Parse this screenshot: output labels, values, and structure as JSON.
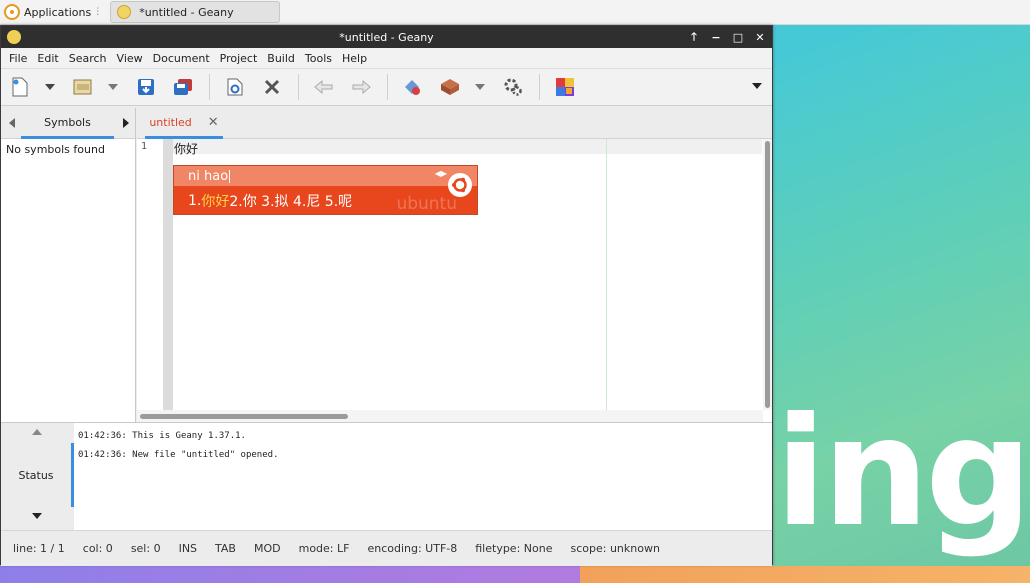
{
  "desktop": {
    "text": "inge"
  },
  "panel": {
    "applications_label": "Applications",
    "task_title": "*untitled - Geany"
  },
  "window": {
    "title": "*untitled - Geany",
    "controls": {
      "up": "🡑",
      "minimize": "−",
      "maximize": "□",
      "close": "✕"
    }
  },
  "menu": {
    "items": [
      "File",
      "Edit",
      "Search",
      "View",
      "Document",
      "Project",
      "Build",
      "Tools",
      "Help"
    ]
  },
  "sidebar": {
    "tab_label": "Symbols",
    "empty_message": "No symbols found"
  },
  "editor": {
    "tab_label": "untitled",
    "line_number": "1",
    "line_text": "你好"
  },
  "ime": {
    "preedit": "ni hao",
    "candidate_first_num": "1.",
    "candidate_first": "你好",
    "candidates_rest": " 2.你 3.拟 4.尼 5.呢",
    "watermark": "ubuntu"
  },
  "messages": {
    "tab_label": "Status",
    "lines": [
      "01:42:36: This is Geany 1.37.1.",
      "01:42:36: New file \"untitled\" opened."
    ]
  },
  "statusbar": {
    "line": "line: 1 / 1",
    "col": "col: 0",
    "sel": "sel: 0",
    "ins": "INS",
    "tab": "TAB",
    "mod": "MOD",
    "mode": "mode: LF",
    "encoding": "encoding: UTF-8",
    "filetype": "filetype: None",
    "scope": "scope: unknown"
  },
  "colors": {
    "accent": "#3b8de0",
    "ime_top": "#f08666",
    "ime_bottom": "#e8461c",
    "tab_text": "#d9432a"
  }
}
